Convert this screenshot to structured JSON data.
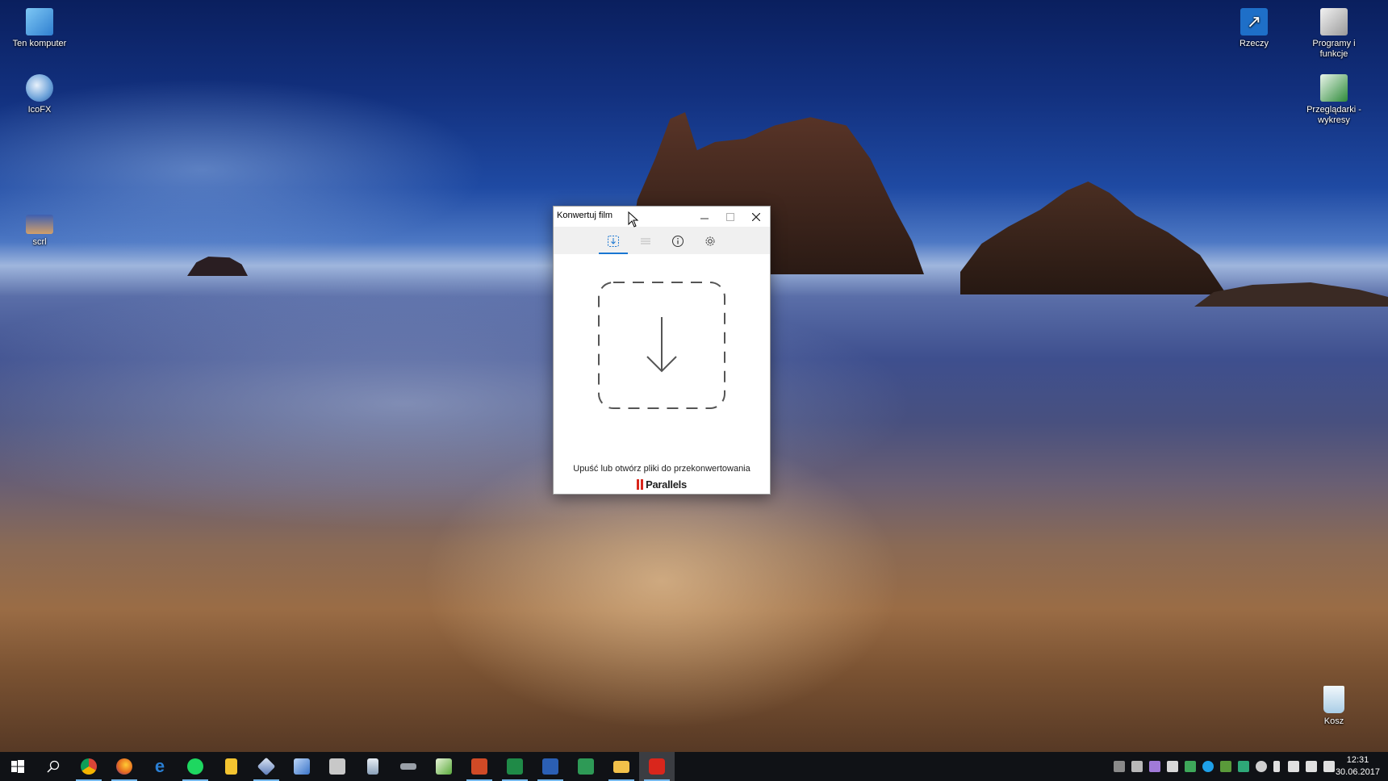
{
  "desktop": {
    "icons": [
      {
        "label": "Ten komputer",
        "icon": "computer-icon",
        "color": "#4aa3e8"
      },
      {
        "label": "IcoFX",
        "icon": "icofx-icon",
        "color": "#6aa0d8"
      },
      {
        "label": "scrl",
        "icon": "image-file-icon",
        "color": "#6f7fb8"
      },
      {
        "label": "Rzeczy",
        "icon": "shortcut-icon",
        "color": "#1e6fc8"
      },
      {
        "label": "Programy i funkcje",
        "icon": "programs-icon",
        "color": "#d8d8d8"
      },
      {
        "label": "Przeglądarki - wykresy",
        "icon": "spreadsheet-icon",
        "color": "#2e8b3a"
      },
      {
        "label": "Kosz",
        "icon": "recycle-bin-icon",
        "color": "#cfe6f5"
      }
    ]
  },
  "window": {
    "title": "Konwertuj film",
    "tabs": [
      {
        "name": "tab-import",
        "icon": "import-icon",
        "active": true
      },
      {
        "name": "tab-queue",
        "icon": "list-icon",
        "active": false
      },
      {
        "name": "tab-info",
        "icon": "info-icon",
        "active": false
      },
      {
        "name": "tab-settings",
        "icon": "gear-icon",
        "active": false
      }
    ],
    "drop_text": "Upuść lub otwórz pliki do przekonwertowania",
    "brand": "Parallels",
    "accent": "#1976d2",
    "brand_color": "#d9261c"
  },
  "taskbar": {
    "apps": [
      {
        "name": "start",
        "icon": "windows-icon",
        "color": "#ffffff"
      },
      {
        "name": "search",
        "icon": "search-icon",
        "color": "#ffffff"
      },
      {
        "name": "chrome",
        "icon": "chrome-icon",
        "color": "#e0a12a"
      },
      {
        "name": "firefox",
        "icon": "firefox-icon",
        "color": "#e66b1f"
      },
      {
        "name": "edge",
        "icon": "edge-icon",
        "color": "#2a7fd4"
      },
      {
        "name": "spotify",
        "icon": "spotify-icon",
        "color": "#1ed760"
      },
      {
        "name": "keep",
        "icon": "note-icon",
        "color": "#f4c430"
      },
      {
        "name": "virtualbox",
        "icon": "cube-icon",
        "color": "#8aa8d8"
      },
      {
        "name": "app-cube",
        "icon": "box-icon",
        "color": "#6aa0e8"
      },
      {
        "name": "latex",
        "icon": "tex-icon",
        "color": "#c8c8c8"
      },
      {
        "name": "jar-app",
        "icon": "jar-icon",
        "color": "#b0c4d8"
      },
      {
        "name": "plane-app",
        "icon": "plane-icon",
        "color": "#9aa0a8"
      },
      {
        "name": "editor",
        "icon": "chart-editor-icon",
        "color": "#5aaa3c"
      },
      {
        "name": "powerpoint",
        "icon": "powerpoint-icon",
        "color": "#d04a26"
      },
      {
        "name": "excel",
        "icon": "excel-icon",
        "color": "#1f8a47"
      },
      {
        "name": "word",
        "icon": "word-icon",
        "color": "#2b5fb4"
      },
      {
        "name": "app-s",
        "icon": "s-app-icon",
        "color": "#2e9a56"
      },
      {
        "name": "explorer",
        "icon": "folder-icon",
        "color": "#f2c14a"
      },
      {
        "name": "video-converter",
        "icon": "video-converter-icon",
        "color": "#d9261c"
      }
    ],
    "clock": {
      "time": "12:31",
      "date": "30.06.2017"
    }
  }
}
